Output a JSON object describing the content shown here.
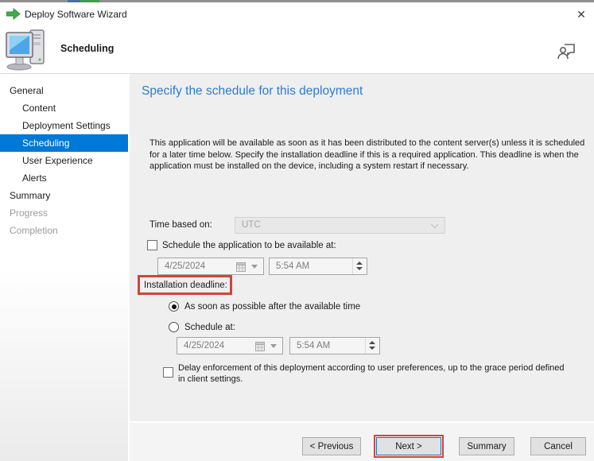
{
  "colors": {
    "selection_blue": "#0078d7",
    "heading_blue": "#2b7cd3",
    "annotation_red": "#d0453c",
    "arrow_green": "#3fae49"
  },
  "window": {
    "title": "Deploy Software Wizard",
    "close_glyph": "✕"
  },
  "header": {
    "title": "Scheduling",
    "icons": {
      "left": "computer-icon",
      "right": "feedback-icon"
    }
  },
  "sidebar": {
    "items": [
      {
        "label": "General",
        "level": 0,
        "state": "enabled"
      },
      {
        "label": "Content",
        "level": 1,
        "state": "enabled"
      },
      {
        "label": "Deployment Settings",
        "level": 1,
        "state": "enabled"
      },
      {
        "label": "Scheduling",
        "level": 1,
        "state": "selected"
      },
      {
        "label": "User Experience",
        "level": 1,
        "state": "enabled"
      },
      {
        "label": "Alerts",
        "level": 1,
        "state": "enabled"
      },
      {
        "label": "Summary",
        "level": 0,
        "state": "enabled"
      },
      {
        "label": "Progress",
        "level": 0,
        "state": "disabled"
      },
      {
        "label": "Completion",
        "level": 0,
        "state": "disabled"
      }
    ]
  },
  "main": {
    "heading": "Specify the schedule for this deployment",
    "intro": "This application will be available as soon as it has been distributed to the content server(s) unless it is scheduled for a later time below. Specify the installation deadline if this is a required application. This deadline is when the application must be installed on the device, including a system restart if necessary.",
    "time_based_on_label": "Time based on:",
    "time_based_on_value": "UTC",
    "available_checkbox_label": "Schedule the application to be available at:",
    "available_checkbox_checked": false,
    "available_date": "4/25/2024",
    "available_time": "5:54 AM",
    "deadline_label": "Installation deadline:",
    "deadline_options": [
      {
        "label": "As soon as possible after the available time",
        "selected": true
      },
      {
        "label": "Schedule at:",
        "selected": false
      }
    ],
    "deadline_date": "4/25/2024",
    "deadline_time": "5:54 AM",
    "delay_checkbox_label": "Delay enforcement of this deployment according to user preferences, up to the grace period defined in client settings.",
    "delay_checkbox_checked": false
  },
  "footer": {
    "buttons": [
      {
        "label": "< Previous",
        "default": false,
        "annotated": false
      },
      {
        "label": "Next >",
        "default": true,
        "annotated": true
      },
      {
        "label": "Summary",
        "default": false,
        "annotated": false
      },
      {
        "label": "Cancel",
        "default": false,
        "annotated": false
      }
    ]
  }
}
